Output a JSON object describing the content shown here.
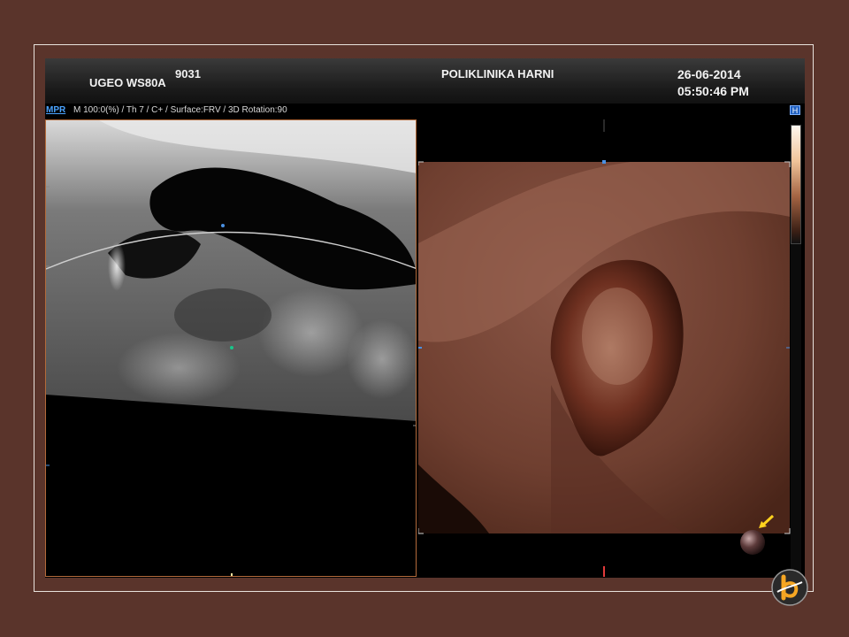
{
  "header": {
    "device": "UGEO WS80A",
    "id": "9031",
    "clinic": "POLIKLINIKA HARNI",
    "date": "26-06-2014",
    "time": "05:50:46 PM"
  },
  "infobar": {
    "tab": "MPR",
    "params": "M 100:0(%) / Th 7 / C+ / Surface:FRV / 3D Rotation:90",
    "button": "H"
  },
  "views": {
    "left": {
      "icon": "mpr-slice-view"
    },
    "right": {
      "icon": "3d-surface-render-view"
    }
  },
  "icons": {
    "orientation": "orientation-sphere-icon",
    "arrow": "yellow-arrow-icon",
    "logo": "presentation-logo-icon"
  },
  "colors": {
    "slide_bg": "#5a342b",
    "header_text": "#f2f2f2",
    "tab_blue": "#4aa3ff",
    "pane_border": "#b36a3a",
    "arrow": "#ffd21e"
  }
}
